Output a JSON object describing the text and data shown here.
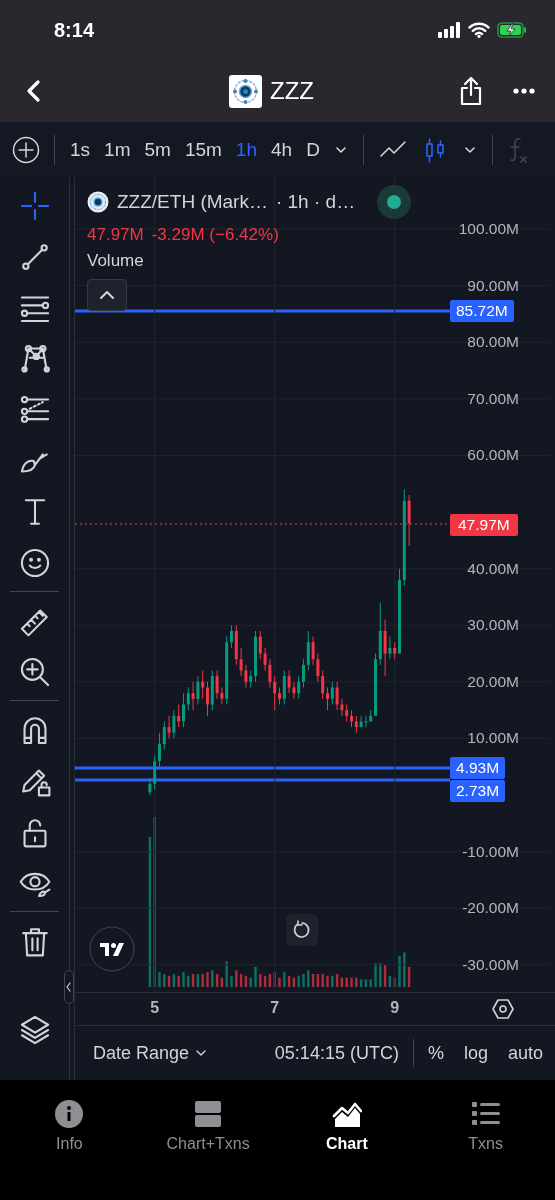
{
  "status_bar": {
    "time": "8:14",
    "battery_charging": true
  },
  "header": {
    "title": "ZZZ"
  },
  "toolbar": {
    "intervals": [
      {
        "label": "1s",
        "selected": false
      },
      {
        "label": "1m",
        "selected": false
      },
      {
        "label": "5m",
        "selected": false
      },
      {
        "label": "15m",
        "selected": false
      },
      {
        "label": "1h",
        "selected": true
      },
      {
        "label": "4h",
        "selected": false
      },
      {
        "label": "D",
        "selected": false
      }
    ],
    "chart_types": [
      {
        "kind": "line",
        "selected": false
      },
      {
        "kind": "candles",
        "selected": true
      }
    ]
  },
  "tool_groups": [
    [
      {
        "kind": "crosshair",
        "selected": true
      },
      {
        "kind": "trend-line",
        "selected": false
      },
      {
        "kind": "horizontal-lines",
        "selected": false
      },
      {
        "kind": "pattern",
        "selected": false
      },
      {
        "kind": "fib",
        "selected": false
      },
      {
        "kind": "brush",
        "selected": false
      },
      {
        "kind": "text",
        "selected": false
      },
      {
        "kind": "emoji",
        "selected": false
      }
    ],
    [
      {
        "kind": "ruler",
        "selected": false
      },
      {
        "kind": "zoom-in",
        "selected": false
      }
    ],
    [
      {
        "kind": "magnet",
        "selected": false
      },
      {
        "kind": "pencil-lock",
        "selected": false
      },
      {
        "kind": "unlock",
        "selected": false
      },
      {
        "kind": "eye",
        "selected": false
      }
    ],
    [
      {
        "kind": "trash",
        "selected": false
      }
    ]
  ],
  "legend": {
    "symbol": "ZZZ/ETH (Mark…",
    "interval": "· 1h · d…",
    "live": true,
    "price": "47.97M",
    "change": "-3.29M (−6.42%)",
    "indicator": "Volume"
  },
  "chart": {
    "chart_data": {
      "type": "candlestick",
      "grid": true,
      "xlim": [
        3.672,
        11.588
      ],
      "ylim": [
        -50.35,
        109.2
      ],
      "xticks": [
        {
          "value": 5,
          "label": "5"
        },
        {
          "value": 7,
          "label": "7"
        },
        {
          "value": 9,
          "label": "9"
        }
      ],
      "yticks": [
        {
          "value": 100,
          "label": "100.00M"
        },
        {
          "value": 90,
          "label": "90.00M"
        },
        {
          "value": 80,
          "label": "80.00M"
        },
        {
          "value": 70,
          "label": "70.00M"
        },
        {
          "value": 60,
          "label": "60.00M"
        },
        {
          "value": 40,
          "label": "40.00M"
        },
        {
          "value": 30,
          "label": "30.00M"
        },
        {
          "value": 20,
          "label": "20.00M"
        },
        {
          "value": 10,
          "label": "10.00M"
        },
        {
          "value": -10,
          "label": "-10.00M"
        },
        {
          "value": -20,
          "label": "-20.00M"
        },
        {
          "value": -30,
          "label": "-30.00M"
        }
      ],
      "x": [
        4.92,
        5,
        5.08,
        5.16,
        5.24,
        5.32,
        5.4,
        5.48,
        5.56,
        5.64,
        5.72,
        5.8,
        5.88,
        5.96,
        6.04,
        6.12,
        6.2,
        6.28,
        6.36,
        6.44,
        6.52,
        6.6,
        6.68,
        6.76,
        6.84,
        6.92,
        7,
        7.08,
        7.16,
        7.24,
        7.32,
        7.4,
        7.48,
        7.56,
        7.64,
        7.72,
        7.8,
        7.88,
        7.96,
        8.04,
        8.12,
        8.2,
        8.28,
        8.36,
        8.44,
        8.52,
        8.6,
        8.68,
        8.76,
        8.84,
        8.92,
        9,
        9.08,
        9.16,
        9.24
      ],
      "ohlc": [
        [
          0.5,
          3,
          0,
          2
        ],
        [
          2,
          7,
          1,
          6
        ],
        [
          6,
          11,
          5,
          9
        ],
        [
          9,
          13,
          8,
          12
        ],
        [
          12,
          14,
          10,
          11
        ],
        [
          11,
          15,
          10,
          14
        ],
        [
          14,
          16,
          12,
          13
        ],
        [
          13,
          18,
          12,
          16
        ],
        [
          16,
          19,
          15,
          18
        ],
        [
          18,
          20,
          15,
          17
        ],
        [
          17,
          21,
          16,
          20
        ],
        [
          20,
          22,
          17,
          19
        ],
        [
          19,
          20,
          14,
          16
        ],
        [
          16,
          22,
          15,
          21
        ],
        [
          21,
          22,
          17,
          18
        ],
        [
          18,
          19,
          16,
          17
        ],
        [
          17,
          28,
          16,
          27
        ],
        [
          27,
          30,
          26,
          29
        ],
        [
          29,
          30,
          23,
          24
        ],
        [
          24,
          26,
          21,
          22
        ],
        [
          22,
          23,
          19,
          20
        ],
        [
          20,
          22,
          19,
          21
        ],
        [
          21,
          29,
          20,
          28
        ],
        [
          28,
          29,
          24,
          25
        ],
        [
          25,
          26,
          22,
          23
        ],
        [
          23,
          24,
          19,
          20
        ],
        [
          20,
          21,
          15,
          18
        ],
        [
          18,
          19,
          16,
          17
        ],
        [
          17,
          22,
          16,
          21
        ],
        [
          21,
          22,
          18,
          19
        ],
        [
          19,
          20,
          17,
          18
        ],
        [
          18,
          21,
          17,
          20
        ],
        [
          20,
          24,
          19,
          23
        ],
        [
          23,
          29,
          22,
          27
        ],
        [
          27,
          28,
          23,
          24
        ],
        [
          24,
          25,
          20,
          21
        ],
        [
          21,
          22,
          17,
          18
        ],
        [
          18,
          19,
          15,
          17
        ],
        [
          17,
          20,
          16,
          19
        ],
        [
          19,
          20,
          15,
          16
        ],
        [
          16,
          17,
          14,
          15
        ],
        [
          15,
          16,
          13,
          14
        ],
        [
          14,
          15,
          12,
          13
        ],
        [
          13,
          14,
          11,
          12
        ],
        [
          12,
          14,
          12,
          13
        ],
        [
          13,
          14,
          12,
          13
        ],
        [
          13,
          15,
          13,
          14
        ],
        [
          14,
          25,
          14,
          24
        ],
        [
          24,
          34,
          23,
          29
        ],
        [
          29,
          31,
          21,
          25
        ],
        [
          25,
          28,
          24,
          26
        ],
        [
          26,
          27,
          24,
          25
        ],
        [
          25,
          40,
          25,
          38
        ],
        [
          38,
          54,
          37,
          52
        ],
        [
          52,
          53,
          44,
          47.97
        ]
      ]
    }
  },
  "horizontal_lines": [
    {
      "label": "85.72M"
    },
    {
      "label": "4.93M"
    },
    {
      "label": "2.73M"
    }
  ],
  "last_price": {
    "label": "47.97M"
  },
  "footer": {
    "date_range": "Date Range",
    "clock": "05:14:15 (UTC)",
    "options": [
      "%",
      "log",
      "auto"
    ]
  },
  "tabs": [
    {
      "label": "Info",
      "kind": "info",
      "selected": false
    },
    {
      "label": "Chart+Txns",
      "kind": "split",
      "selected": false
    },
    {
      "label": "Chart",
      "kind": "chart",
      "selected": true
    },
    {
      "label": "Txns",
      "kind": "list",
      "selected": false
    }
  ]
}
